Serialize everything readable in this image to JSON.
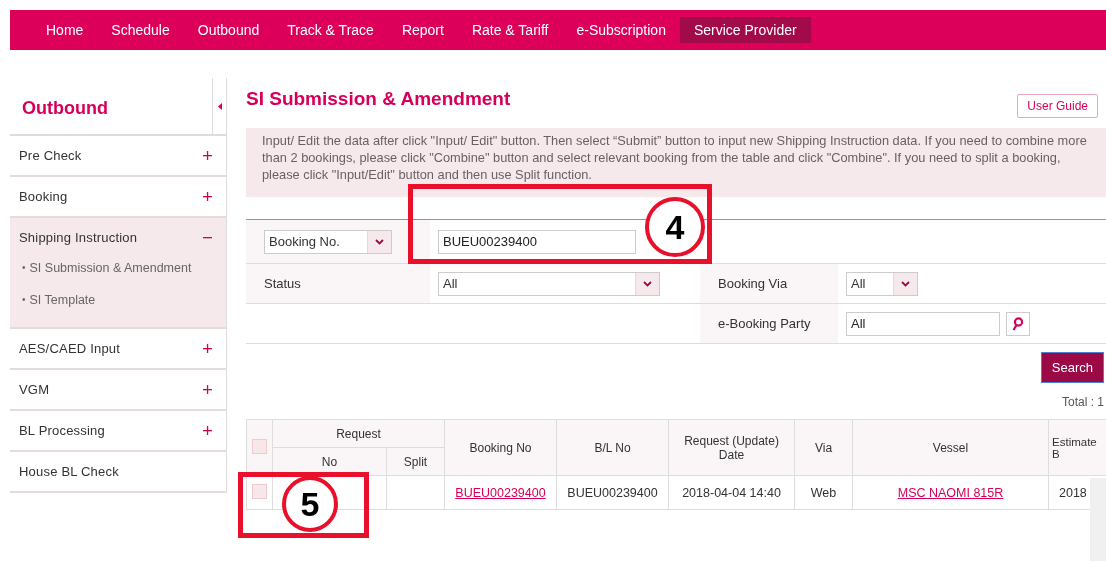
{
  "nav": [
    {
      "label": "Home",
      "selected": false
    },
    {
      "label": "Schedule",
      "selected": false
    },
    {
      "label": "Outbound",
      "selected": false
    },
    {
      "label": "Track & Trace",
      "selected": false
    },
    {
      "label": "Report",
      "selected": false
    },
    {
      "label": "Rate & Tariff",
      "selected": false
    },
    {
      "label": "e-Subscription",
      "selected": false
    },
    {
      "label": "Service Provider",
      "selected": true
    }
  ],
  "sidebar": {
    "title": "Outbound",
    "items": [
      {
        "label": "Pre Check",
        "kind": "group",
        "expanded": false
      },
      {
        "label": "Booking",
        "kind": "group",
        "expanded": false
      },
      {
        "label": "Shipping Instruction",
        "kind": "group",
        "expanded": true,
        "children": [
          {
            "bullet": "•",
            "label": "SI Submission & Amendment"
          },
          {
            "bullet": "•",
            "label": "SI Template"
          }
        ]
      },
      {
        "label": "AES/CAED Input",
        "kind": "group",
        "expanded": false
      },
      {
        "label": "VGM",
        "kind": "group",
        "expanded": false
      },
      {
        "label": "BL Processing",
        "kind": "group",
        "expanded": false
      },
      {
        "label": "House BL Check",
        "kind": "link",
        "expanded": false
      }
    ]
  },
  "page_title": "SI Submission & Amendment",
  "user_guide": "User Guide",
  "notice": "Input/ Edit the data after click \"Input/ Edit\" button. Then select “Submit” button to input new Shipping Instruction data. If you need to combine more than 2 bookings, please click \"Combine\" button and select relevant booking from the table and click \"Combine\". If you need to split a booking, please click \"Input/Edit\" button and then use Split function.",
  "filters": {
    "key_select": "Booking No.",
    "key_value": "BUEU00239400",
    "status_label": "Status",
    "status_value": "All",
    "via_label": "Booking Via",
    "via_value": "All",
    "party_label": "e-Booking Party",
    "party_value": "All"
  },
  "search_button": "Search",
  "total": "Total : 1",
  "table": {
    "group_header": "Request",
    "columns": [
      "No",
      "Split",
      "Booking No",
      "B/L No",
      "Request (Update) Date",
      "Via",
      "Vessel",
      "Estimate B"
    ],
    "rows": [
      {
        "checked": false,
        "cells": [
          "",
          "",
          "BUEU00239400",
          "BUEU00239400",
          "2018-04-04 14:40",
          "Web",
          "MSC NAOMI 815R",
          "2018"
        ]
      }
    ],
    "header_checked": false
  },
  "annotations": [
    {
      "label": "4"
    },
    {
      "label": "5"
    }
  ]
}
